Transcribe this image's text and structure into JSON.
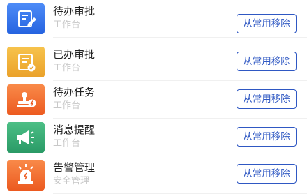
{
  "items": [
    {
      "title": "待办审批",
      "subtitle": "工作台",
      "button": "从常用移除",
      "icon": "edit-document-icon",
      "color_from": "#4d8bf7",
      "color_to": "#2563e0"
    },
    {
      "title": "已办审批",
      "subtitle": "工作台",
      "button": "从常用移除",
      "icon": "approved-document-icon",
      "color_from": "#f7c34c",
      "color_to": "#eaa12a"
    },
    {
      "title": "待办任务",
      "subtitle": "工作台",
      "button": "从常用移除",
      "icon": "stamp-icon",
      "color_from": "#f98a49",
      "color_to": "#ec5a20"
    },
    {
      "title": "消息提醒",
      "subtitle": "工作台",
      "button": "从常用移除",
      "icon": "megaphone-icon",
      "color_from": "#4cbf86",
      "color_to": "#2a9a66"
    },
    {
      "title": "告警管理",
      "subtitle": "安全管理",
      "button": "从常用移除",
      "icon": "alarm-light-icon",
      "color_from": "#f98a49",
      "color_to": "#ec5a20"
    }
  ]
}
